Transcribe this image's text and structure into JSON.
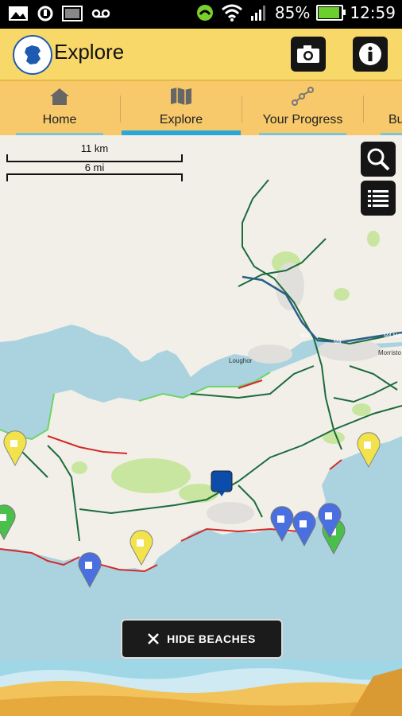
{
  "status_bar": {
    "battery_percent": "85%",
    "time": "12:59",
    "battery_level": 0.85,
    "icons": [
      "picture-icon",
      "sync-icon",
      "image-icon",
      "voicemail-icon",
      "phone-mute-icon",
      "wifi-icon",
      "signal-icon",
      "battery-icon"
    ]
  },
  "app_bar": {
    "title": "Explore",
    "icons": [
      "wales-logo-icon",
      "camera-icon",
      "info-icon"
    ]
  },
  "tabs": [
    {
      "label": "Home",
      "icon": "home-icon",
      "active": false
    },
    {
      "label": "Explore",
      "icon": "map-icon",
      "active": true
    },
    {
      "label": "Your Progress",
      "icon": "progress-icon",
      "active": false
    },
    {
      "label": "Bu",
      "icon": "",
      "active": false
    }
  ],
  "map": {
    "scale_km": "11 km",
    "scale_mi": "6 mi",
    "place_labels": [
      "Loughor",
      "M4",
      "M4",
      "M4 M4",
      "Morristo"
    ],
    "map_buttons": [
      "search-icon",
      "list-icon"
    ],
    "colors": {
      "sea": "#aad3df",
      "land": "#f2efe9",
      "park": "#c8e6a0",
      "road": "#1c6b3d",
      "motorway": "#2a5f8a"
    }
  },
  "hide_beaches_button": {
    "label": "HIDE BEACHES",
    "icon": "close-icon"
  }
}
